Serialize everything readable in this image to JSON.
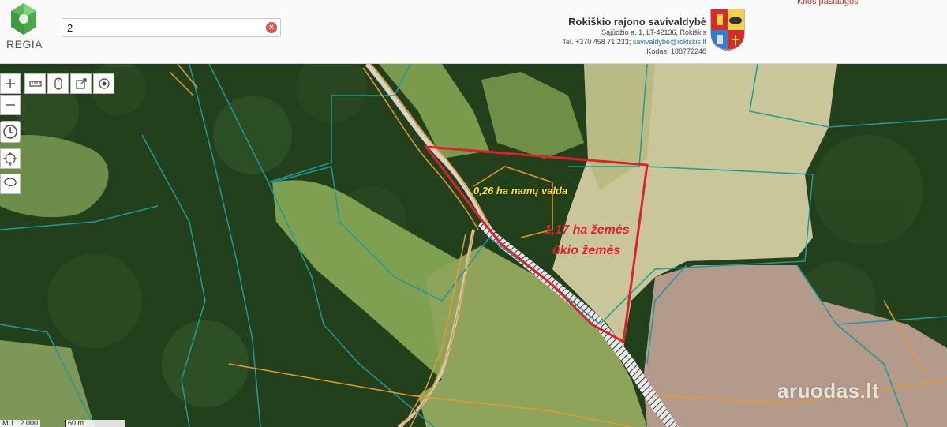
{
  "header": {
    "logo_text": "REGIA",
    "search_value": "2",
    "clear_label": "×",
    "top_link": "Kitos paslaugos",
    "municipality": {
      "name": "Rokiškio rajono savivaldybė",
      "address": "Sąjūdžio a. 1, LT-42136, Rokiškis",
      "phone": "Tel. +370 458 71 233; ",
      "email": "savivaldybe@rokiskis.lt",
      "code": "Kodas: 188772248"
    }
  },
  "toolbar": {
    "zoom_in": "zoom-in-icon",
    "zoom_out": "zoom-out-icon",
    "tools": [
      "ruler-icon",
      "mouse-icon",
      "export-icon",
      "target-icon"
    ],
    "side_tools": [
      "clock-icon",
      "crosshair-icon",
      "lasso-icon"
    ]
  },
  "map": {
    "labels": {
      "house_plot": "0,26 ha namų valda",
      "farm_land_1": "1,17 ha žemės",
      "farm_land_2": "ūkio žemės"
    },
    "colors": {
      "highlight": "#e0202c",
      "parcel_lines": "#1e9a9a",
      "road_lines": "#e69a2e",
      "label_yellow": "#f5e431"
    }
  },
  "footer": {
    "scale": "M 1 : 2 000",
    "distance": "60 m",
    "watermark": "aruodas.lt"
  }
}
